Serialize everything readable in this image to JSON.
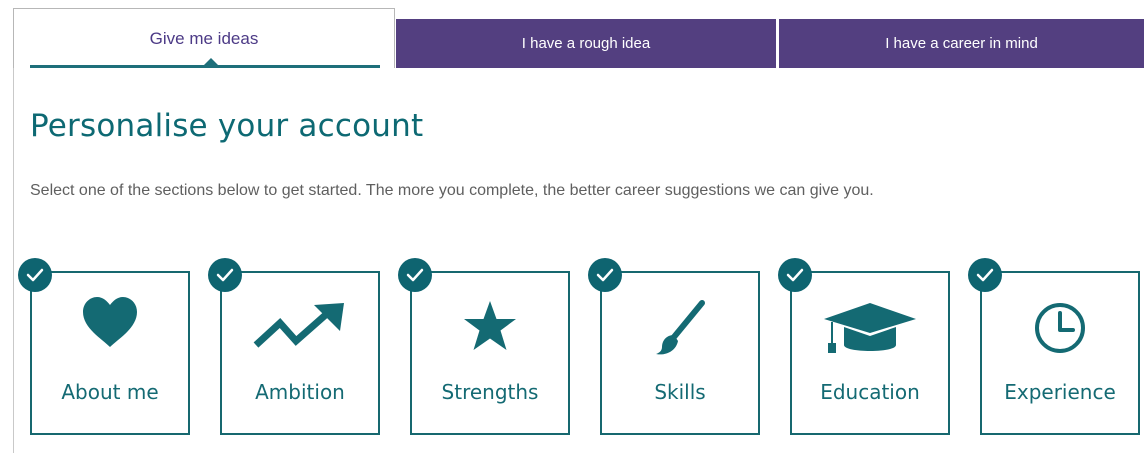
{
  "tabs": [
    {
      "label": "Give me ideas",
      "active": true
    },
    {
      "label": "I have a rough idea",
      "active": false
    },
    {
      "label": "I have a career in mind",
      "active": false
    }
  ],
  "heading": "Personalise your account",
  "intro": "Select one of the sections below to get started. The more you complete, the better career suggestions we can give you.",
  "sections": [
    {
      "label": "About me",
      "icon": "heart-icon",
      "completed": true
    },
    {
      "label": "Ambition",
      "icon": "trend-up-icon",
      "completed": true
    },
    {
      "label": "Strengths",
      "icon": "star-icon",
      "completed": true
    },
    {
      "label": "Skills",
      "icon": "paintbrush-icon",
      "completed": true
    },
    {
      "label": "Education",
      "icon": "graduation-cap-icon",
      "completed": true
    },
    {
      "label": "Experience",
      "icon": "clock-icon",
      "completed": true
    }
  ],
  "colors": {
    "teal": "#146a73",
    "purple_tab": "#533f80",
    "purple_text": "#4c3a86"
  }
}
